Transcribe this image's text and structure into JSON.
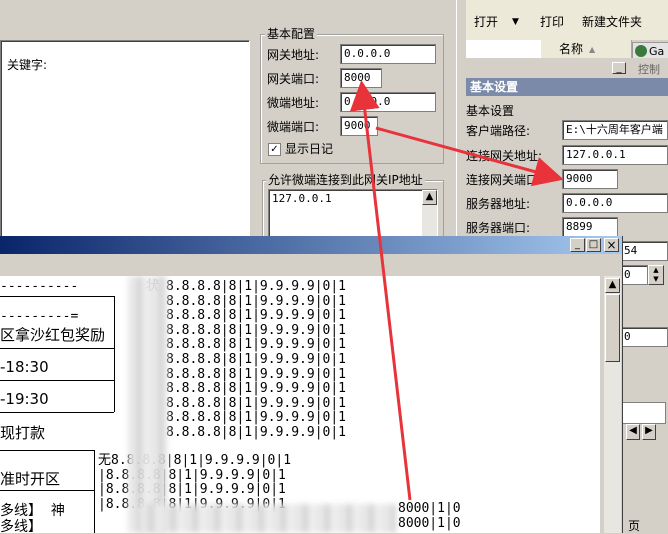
{
  "left_panel": {
    "keyword_label": "关键字:"
  },
  "basic_config": {
    "title": "基本配置",
    "gateway_address_label": "网关地址:",
    "gateway_address_value": "0.0.0.0",
    "gateway_port_label": "网关端口:",
    "gateway_port_value": "8000",
    "client_address_label": "微端地址:",
    "client_address_value": "0.0.0.0",
    "client_port_label": "微端端口:",
    "client_port_value": "9000",
    "show_log_label": "显示日记",
    "show_log_checked": true
  },
  "allowed_ip": {
    "title": "允许微端连接到此网关IP地址",
    "list": [
      "127.0.0.1"
    ]
  },
  "explorer": {
    "toolbar": {
      "open": "打开",
      "print": "打印",
      "new_folder": "新建文件夹"
    },
    "name_column": "名称",
    "name_sort_glyph": "▲",
    "app_tab_label": "Ga",
    "control_label": "控制"
  },
  "basic_settings": {
    "header": "基本设置",
    "group_title": "基本设置",
    "client_path_label": "客户端路径:",
    "client_path_value": "E:\\十六周年客户端",
    "gateway_address_label": "连接网关地址:",
    "gateway_address_value": "127.0.0.1",
    "gateway_port_label": "连接网关端口:",
    "gateway_port_value": "9000",
    "server_address_label": "服务器地址:",
    "server_address_value": "0.0.0.0",
    "server_port_label": "服务器端口:",
    "server_port_value": "8899",
    "extra_value_1": "54",
    "extra_value_2": "0",
    "extra_value_3": "0",
    "bottom_glyph": "页"
  },
  "console_window": {
    "left_column": [
      "----------",
      "",
      "---------=",
      "区拿沙红包奖励",
      "",
      "-18:30",
      "",
      "-19:30",
      "",
      "现打款",
      "",
      "",
      "准时开区",
      "",
      "多线】  神",
      "多线】"
    ],
    "partial_word": "状",
    "rows_right": [
      "8.8.8.8|8|1|9.9.9.9|0|1",
      "8.8.8.8|8|1|9.9.9.9|0|1",
      "8.8.8.8|8|1|9.9.9.9|0|1",
      "8.8.8.8|8|1|9.9.9.9|0|1",
      "8.8.8.8|8|1|9.9.9.9|0|1",
      "8.8.8.8|8|1|9.9.9.9|0|1",
      "8.8.8.8|8|1|9.9.9.9|0|1",
      "8.8.8.8|8|1|9.9.9.9|0|1",
      "8.8.8.8|8|1|9.9.9.9|0|1",
      "8.8.8.8|8|1|9.9.9.9|0|1",
      "8.8.8.8|8|1|9.9.9.9|0|1"
    ],
    "rows_lower": [
      "8.8.8.8|8|1|9.9.9.9|0|1",
      "8.8.8.8|8|1|9.9.9.9|0|1",
      "8.8.8.8|8|1|9.9.9.9|0|1",
      "8.8.8.8|8|1|9.9.9.9|0|1"
    ],
    "rows_bottom_right": [
      "8000|1|0",
      "8000|1|0"
    ],
    "row_prefix_glyph": "无",
    "row_prefix_bar": "|",
    "controls": {
      "minimize": "_",
      "maximize": "□",
      "close": "×"
    }
  },
  "colors": {
    "arrow": "#e8333a",
    "titlebar": "#0a246a",
    "panel_header": "#7b8aa8"
  }
}
